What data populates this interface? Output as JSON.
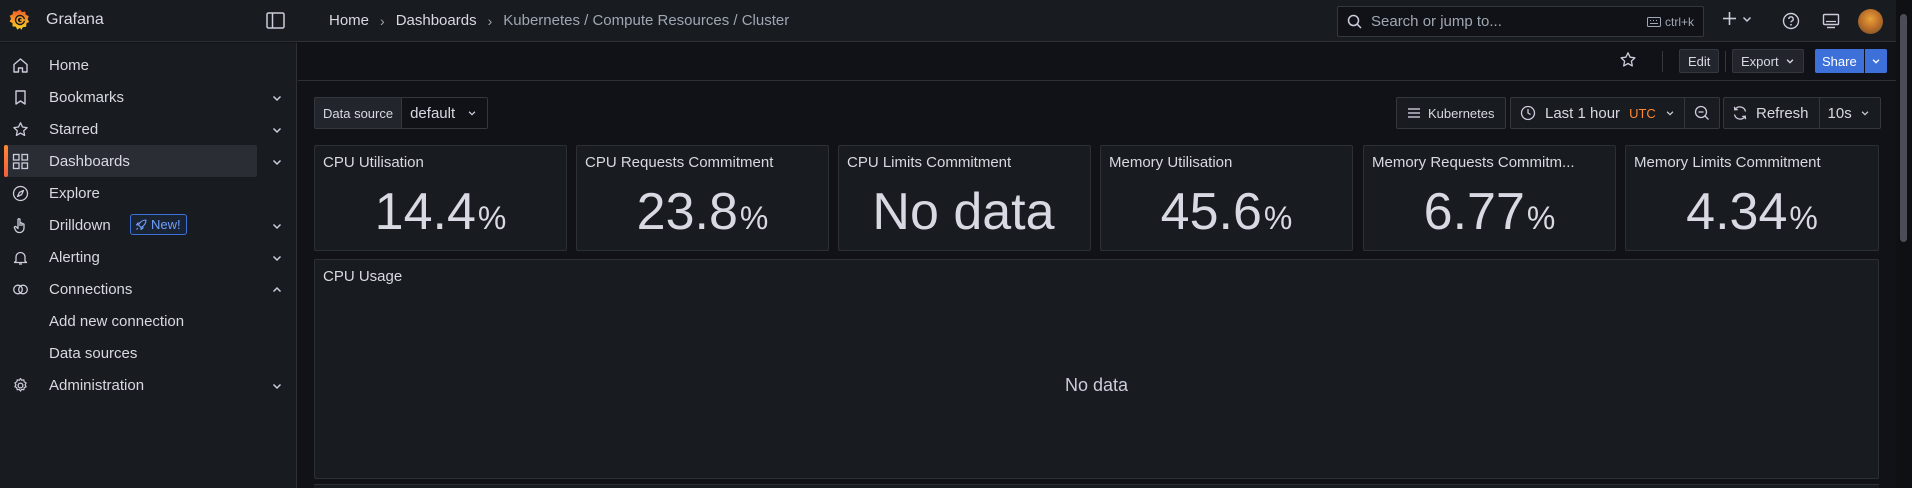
{
  "app": {
    "brand": "Grafana"
  },
  "breadcrumb": [
    "Home",
    "Dashboards",
    "Kubernetes / Compute Resources / Cluster"
  ],
  "search": {
    "placeholder": "Search or jump to...",
    "shortcut": "ctrl+k"
  },
  "sidebar": {
    "items": [
      {
        "label": "Home",
        "icon": "home-icon"
      },
      {
        "label": "Bookmarks",
        "icon": "bookmark-icon"
      },
      {
        "label": "Starred",
        "icon": "star-icon"
      },
      {
        "label": "Dashboards",
        "icon": "apps-icon",
        "active": true
      },
      {
        "label": "Explore",
        "icon": "compass-icon"
      },
      {
        "label": "Drilldown",
        "icon": "drilldown-icon",
        "badge": "New!"
      },
      {
        "label": "Alerting",
        "icon": "bell-icon"
      },
      {
        "label": "Connections",
        "icon": "connections-icon",
        "expanded": true
      },
      {
        "label": "Administration",
        "icon": "cog-icon"
      }
    ],
    "sub_items": [
      "Add new connection",
      "Data sources"
    ]
  },
  "toolbar": {
    "edit": "Edit",
    "export": "Export",
    "share": "Share"
  },
  "datasource": {
    "label": "Data source",
    "value": "default"
  },
  "controls": {
    "kubernetes": "Kubernetes",
    "time_range": "Last 1 hour",
    "timezone": "UTC",
    "refresh": "Refresh",
    "interval": "10s"
  },
  "stats": [
    {
      "title": "CPU Utilisation",
      "value": "14.4",
      "unit": "%"
    },
    {
      "title": "CPU Requests Commitment",
      "value": "23.8",
      "unit": "%"
    },
    {
      "title": "CPU Limits Commitment",
      "value": "No data",
      "unit": ""
    },
    {
      "title": "Memory Utilisation",
      "value": "45.6",
      "unit": "%"
    },
    {
      "title": "Memory Requests Commitm...",
      "value": "6.77",
      "unit": "%"
    },
    {
      "title": "Memory Limits Commitment",
      "value": "4.34",
      "unit": "%"
    }
  ],
  "cpu_usage": {
    "title": "CPU Usage",
    "empty": "No data"
  },
  "colors": {
    "accent": "#3d71d9",
    "brand_orange": "#ff8833",
    "background": "#111217",
    "panel": "#181b1f"
  }
}
